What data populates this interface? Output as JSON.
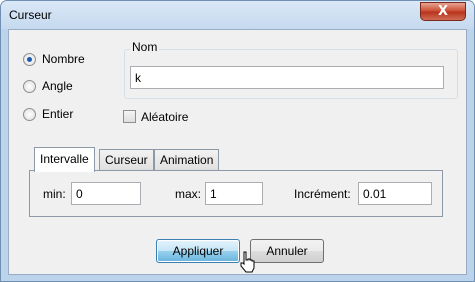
{
  "window": {
    "title": "Curseur",
    "close_label": "X"
  },
  "type_options": [
    {
      "label": "Nombre",
      "checked": true
    },
    {
      "label": "Angle",
      "checked": false
    },
    {
      "label": "Entier",
      "checked": false
    }
  ],
  "nom": {
    "legend": "Nom",
    "value": "k"
  },
  "aleatoire": {
    "label": "Aléatoire",
    "checked": false
  },
  "tabs": [
    {
      "label": "Intervalle",
      "active": true
    },
    {
      "label": "Curseur",
      "active": false
    },
    {
      "label": "Animation",
      "active": false
    }
  ],
  "intervalle": {
    "min_label": "min:",
    "min_value": "0",
    "max_label": "max:",
    "max_value": "1",
    "increment_label": "Incrément:",
    "increment_value": "0.01"
  },
  "buttons": {
    "apply_label": "Appliquer",
    "cancel_label": "Annuler"
  }
}
